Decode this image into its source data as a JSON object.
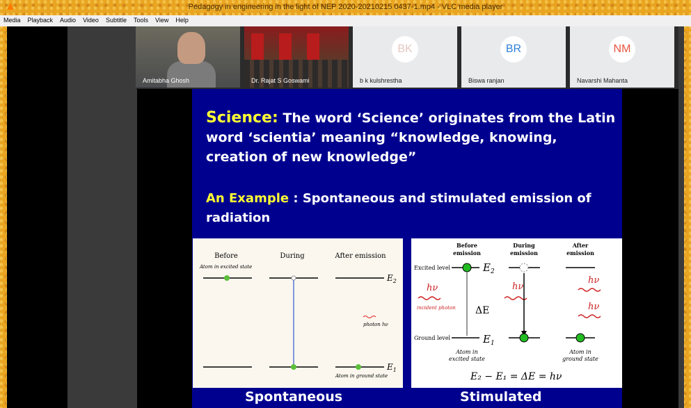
{
  "window": {
    "title": "Pedagogy in engineering in the light of NEP 2020-20210215 0437-1.mp4 - VLC media player"
  },
  "menu": [
    "Media",
    "Playback",
    "Audio",
    "Video",
    "Subtitle",
    "Tools",
    "View",
    "Help"
  ],
  "participants": [
    {
      "name": "Amitabha Ghosh",
      "initials": ""
    },
    {
      "name": "Dr. Rajat S Goswami",
      "initials": ""
    },
    {
      "name": "b k kulshrestha",
      "initials": "BK",
      "color": "#e6c7c3"
    },
    {
      "name": "Biswa ranjan",
      "initials": "BR",
      "color": "#2e7fd6"
    },
    {
      "name": "Navarshi Mahanta",
      "initials": "NM",
      "color": "#e8553e"
    }
  ],
  "slide": {
    "science_label": "Science:",
    "science_text": " The word ‘Science’ originates from the Latin word ‘scientia’ meaning “knowledge, knowing, creation of new knowledge”",
    "example_label": "An Example",
    "example_text": " :  Spontaneous and stimulated emission of radiation",
    "spontaneous": {
      "before": "Before",
      "during": "During",
      "after": "After emission",
      "excited_note": "Atom in excited state",
      "ground_note": "Atom in ground state",
      "photon": "photon hν",
      "e2": "E",
      "e2sub": "2",
      "e1": "E",
      "e1sub": "1"
    },
    "stimulated": {
      "before": "Before",
      "before2": "emission",
      "during": "During",
      "during2": "emission",
      "after": "After",
      "after2": "emission",
      "excited_level": "Excited level",
      "ground_level": "Ground level",
      "e2": "E",
      "e2sub": "2",
      "e1": "E",
      "e1sub": "1",
      "hv": "hν",
      "incident": "incident photon",
      "delta": "ΔE",
      "atom_excited1": "Atom in",
      "atom_excited2": "excited state",
      "atom_ground1": "Atom in",
      "atom_ground2": "ground state",
      "equation": "E₂ − E₁ = ΔE = hν"
    },
    "caption_left": "Spontaneous",
    "caption_right": "Stimulated"
  },
  "colors": {
    "slide_bg": "#00008f",
    "highlight": "#ffff33",
    "frame": "#e9a521"
  }
}
